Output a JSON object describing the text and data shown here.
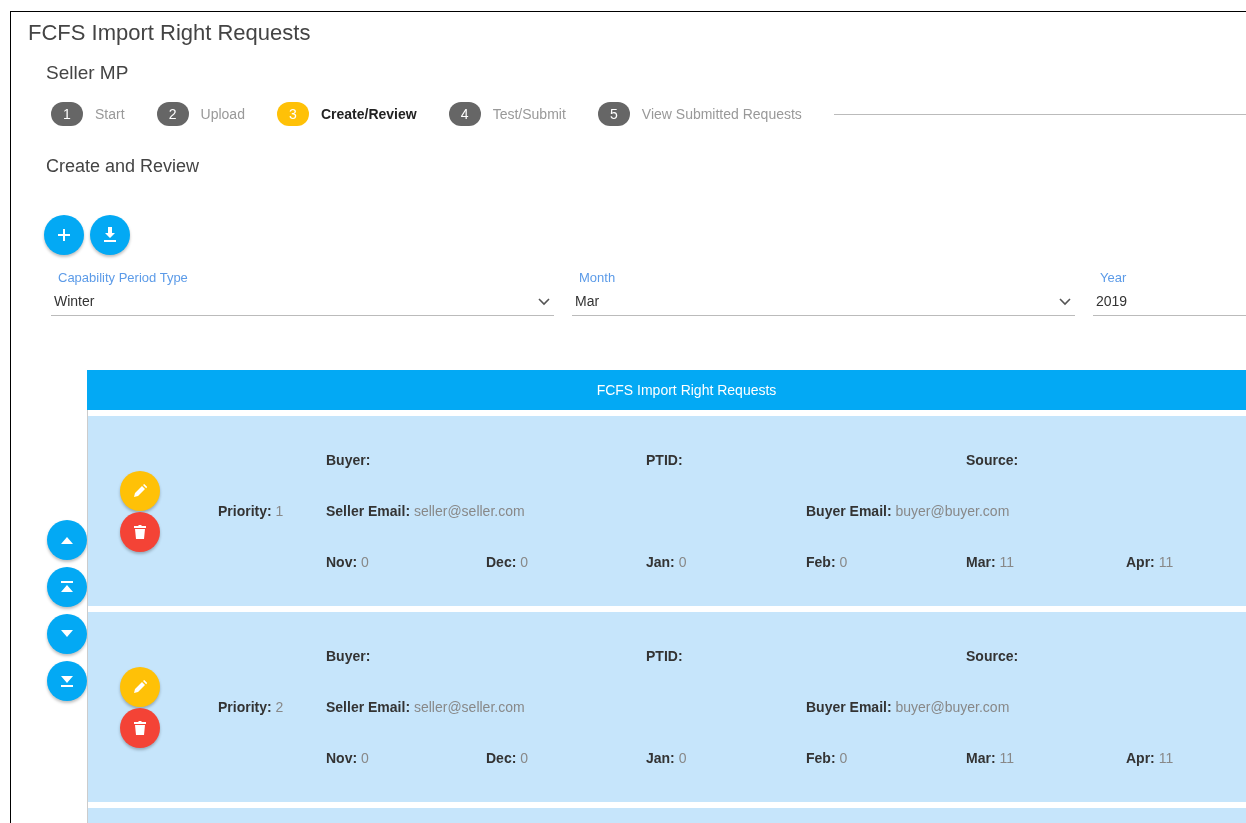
{
  "window": {
    "title": "FCFS Import Right Requests"
  },
  "subtitle": "Seller MP",
  "steps": [
    {
      "number": "1",
      "label": "Start",
      "selected": false
    },
    {
      "number": "2",
      "label": "Upload",
      "selected": false
    },
    {
      "number": "3",
      "label": "Create/Review",
      "selected": true
    },
    {
      "number": "4",
      "label": "Test/Submit",
      "selected": false
    },
    {
      "number": "5",
      "label": "View Submitted Requests",
      "selected": false
    }
  ],
  "section_title": "Create and Review",
  "filters": [
    {
      "kind": "select",
      "label": "Capability Period Type",
      "value": "Winter"
    },
    {
      "kind": "select",
      "label": "Month",
      "value": "Mar"
    },
    {
      "kind": "text",
      "label": "Year",
      "value": "2019"
    }
  ],
  "table": {
    "title": "FCFS Import Right Requests",
    "rows": [
      {
        "priority": {
          "label": "Priority:",
          "value": "1"
        },
        "top_fields": [
          {
            "label": "Buyer:"
          },
          {
            "label": "PTID:"
          },
          {
            "label": "Source:"
          }
        ],
        "emails": [
          {
            "label": "Seller Email:",
            "value": "seller@seller.com"
          },
          {
            "label": "Buyer Email:",
            "value": "buyer@buyer.com"
          }
        ],
        "months": [
          {
            "label": "Nov:",
            "value": "0"
          },
          {
            "label": "Dec:",
            "value": "0"
          },
          {
            "label": "Jan:",
            "value": "0"
          },
          {
            "label": "Feb:",
            "value": "0"
          },
          {
            "label": "Mar:",
            "value": "11"
          },
          {
            "label": "Apr:",
            "value": "11"
          }
        ]
      },
      {
        "priority": {
          "label": "Priority:",
          "value": "2"
        },
        "top_fields": [
          {
            "label": "Buyer:"
          },
          {
            "label": "PTID:"
          },
          {
            "label": "Source:"
          }
        ],
        "emails": [
          {
            "label": "Seller Email:",
            "value": "seller@seller.com"
          },
          {
            "label": "Buyer Email:",
            "value": "buyer@buyer.com"
          }
        ],
        "months": [
          {
            "label": "Nov:",
            "value": "0"
          },
          {
            "label": "Dec:",
            "value": "0"
          },
          {
            "label": "Jan:",
            "value": "0"
          },
          {
            "label": "Feb:",
            "value": "0"
          },
          {
            "label": "Mar:",
            "value": "11"
          },
          {
            "label": "Apr:",
            "value": "11"
          }
        ]
      }
    ]
  }
}
